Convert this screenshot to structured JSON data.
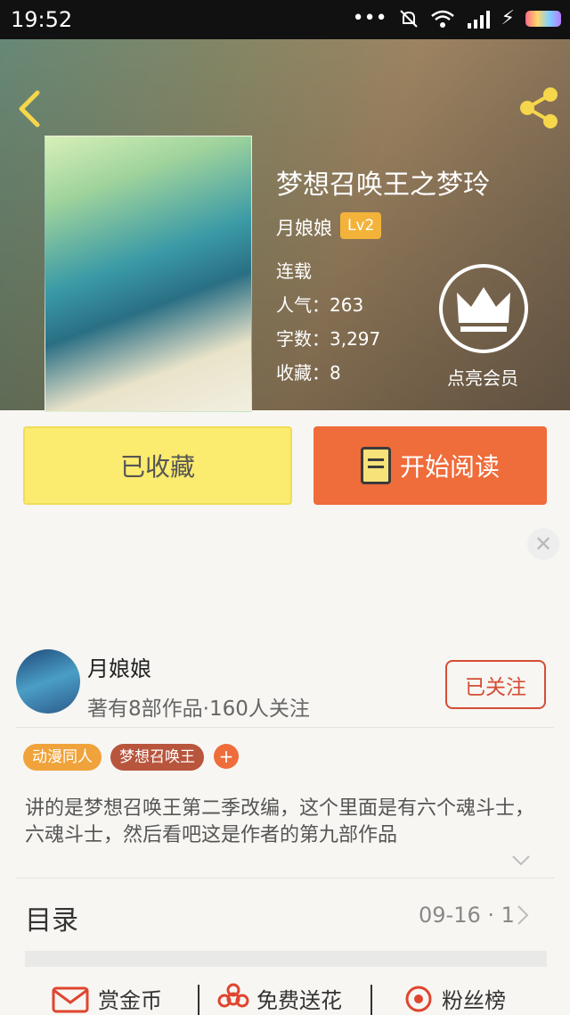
{
  "status_bar": {
    "time": "19:52",
    "icons": [
      "more-dots-icon",
      "mute-bell-icon",
      "wifi-icon",
      "signal-icon",
      "charging-icon",
      "battery-icon"
    ]
  },
  "header": {
    "back_icon": "back-arrow-icon",
    "share_icon": "share-icon"
  },
  "book": {
    "title": "梦想召唤王之梦玲",
    "author": "月娘娘",
    "level": "Lv2",
    "status": "连载",
    "popularity": "人气：263",
    "word_count": "字数：3,297",
    "favorites": "收藏：8",
    "vip_label": "点亮会员"
  },
  "actions": {
    "collect_label": "已收藏",
    "read_label": "开始阅读"
  },
  "ad": {
    "close_symbol": "✕"
  },
  "author_card": {
    "name": "月娘娘",
    "info": "著有8部作品·160人关注",
    "follow_label": "已关注"
  },
  "tags": {
    "items": [
      "动漫同人",
      "梦想召唤王"
    ],
    "add_symbol": "+"
  },
  "description": "讲的是梦想召唤王第二季改编，这个里面是有六个魂斗士，六魂斗士，然后看吧这是作者的第九部作品",
  "toc": {
    "label": "目录",
    "latest": "09-16 · 1"
  },
  "bottom_bar": {
    "items": [
      {
        "label": "赏金币",
        "icon": "coin-envelope-icon"
      },
      {
        "label": "免费送花",
        "icon": "flower-icon"
      },
      {
        "label": "粉丝榜",
        "icon": "ranking-icon"
      }
    ]
  },
  "colors": {
    "accent_orange": "#ef6c3b",
    "collect_yellow": "#fbeb6f",
    "level_badge": "#f3b33a",
    "follow_red": "#d54d35",
    "tag_orange": "#f0a33a",
    "tag_brown": "#b8553d"
  }
}
